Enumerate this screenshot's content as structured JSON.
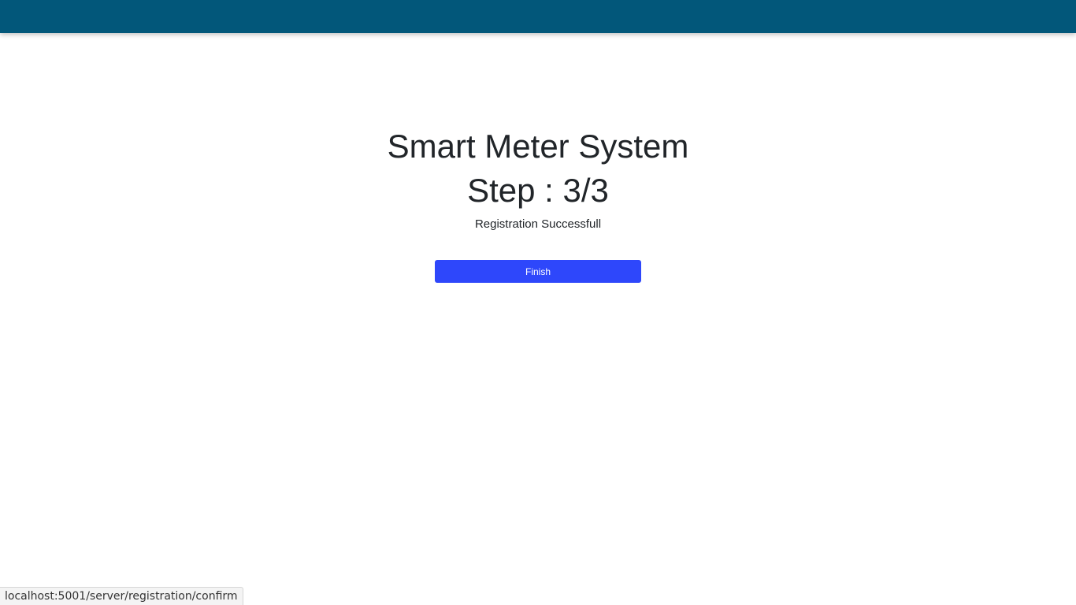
{
  "header": {
    "background_color": "#02577a"
  },
  "main": {
    "title": "Smart Meter System",
    "step": "Step : 3/3",
    "message": "Registration Successfull",
    "finish_button_label": "Finish",
    "button_color": "#2e47fb"
  },
  "browser_status": {
    "url": "localhost:5001/server/registration/confirm"
  }
}
